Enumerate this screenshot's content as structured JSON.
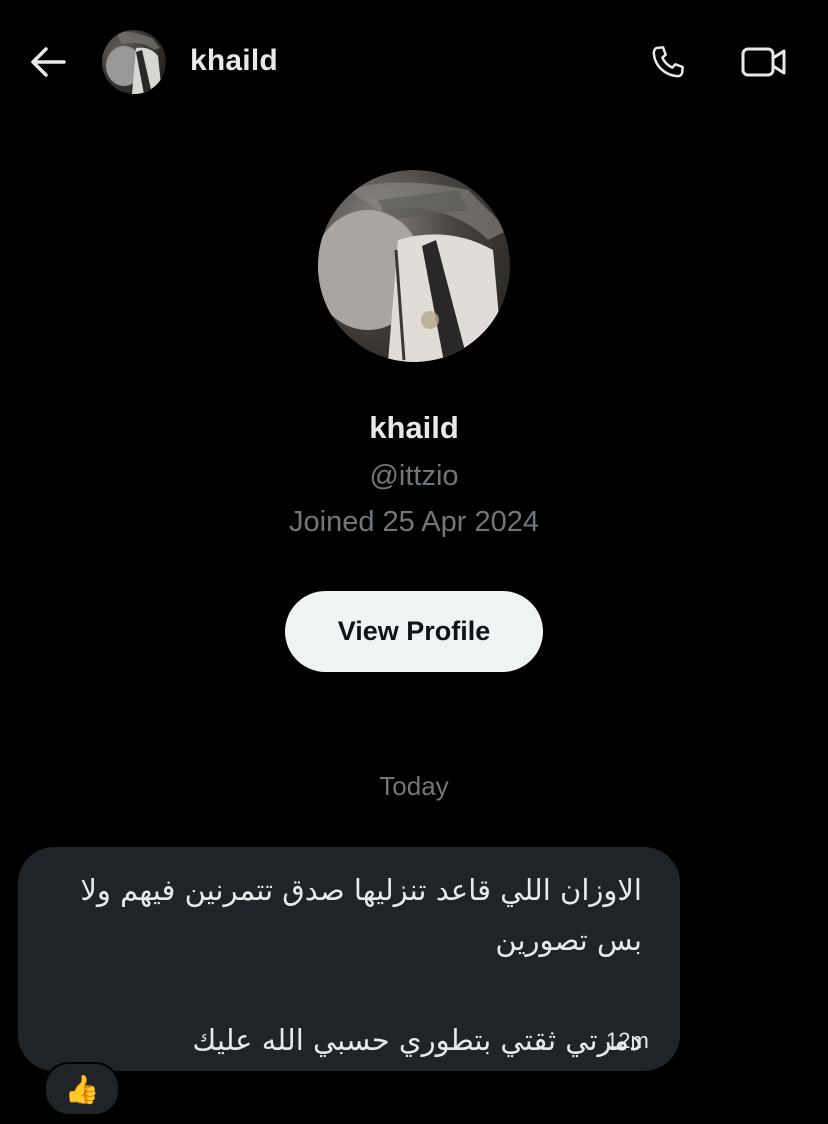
{
  "header": {
    "back_icon": "arrow-left-icon",
    "avatar_icon": "user-avatar",
    "name": "khaild",
    "call_icon": "phone-icon",
    "video_icon": "video-camera-icon"
  },
  "profile": {
    "avatar_icon": "user-avatar",
    "name": "khaild",
    "handle": "@ittzio",
    "joined": "Joined 25 Apr 2024",
    "view_profile_label": "View Profile"
  },
  "conversation": {
    "date_separator": "Today",
    "messages": [
      {
        "text": "الاوزان اللي قاعد تنزليها صدق تتمرنين فيهم ولا بس تصورين\n\nدمرتي ثقتي بتطوري حسبي الله عليك",
        "time": "12m",
        "reaction": "👍"
      }
    ]
  },
  "colors": {
    "background": "#000000",
    "text_primary": "#e7e9ea",
    "text_secondary": "#71767b",
    "bubble": "#202327",
    "button_bg": "#eff3f4",
    "button_text": "#0f1419"
  }
}
